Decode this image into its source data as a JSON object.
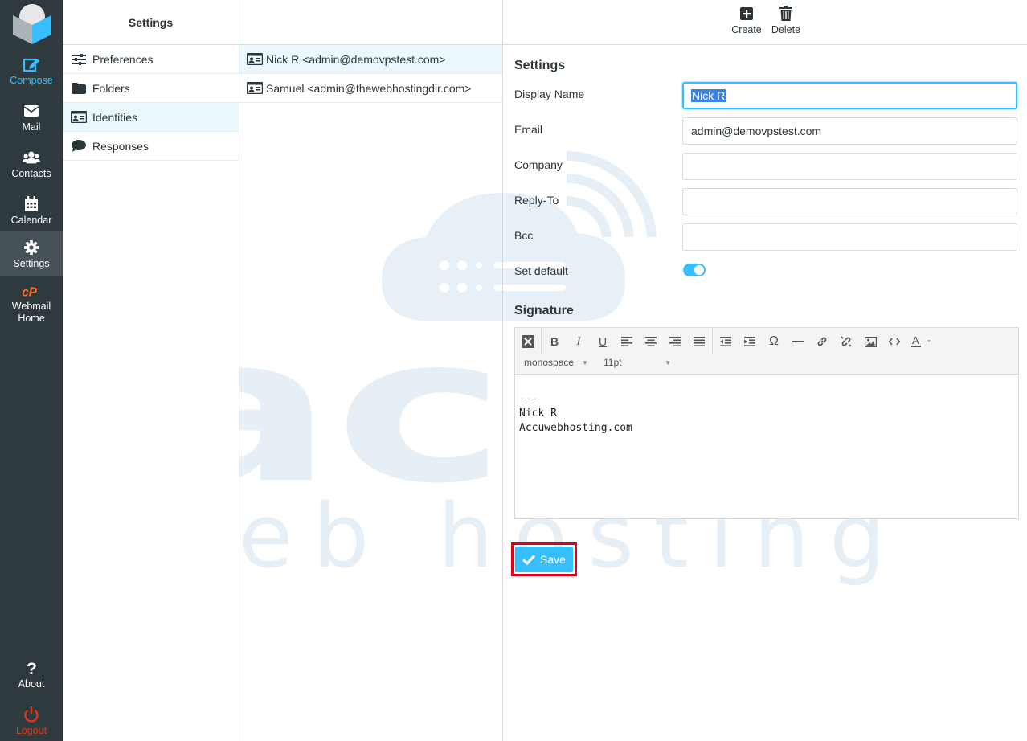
{
  "taskmenu": {
    "items": [
      {
        "label": "Compose"
      },
      {
        "label": "Mail"
      },
      {
        "label": "Contacts"
      },
      {
        "label": "Calendar"
      },
      {
        "label": "Settings"
      },
      {
        "label": "Webmail Home"
      },
      {
        "label": "About"
      },
      {
        "label": "Logout"
      }
    ]
  },
  "settings_panel": {
    "title": "Settings",
    "items": [
      {
        "label": "Preferences",
        "icon": "sliders-icon"
      },
      {
        "label": "Folders",
        "icon": "folder-icon"
      },
      {
        "label": "Identities",
        "icon": "id-card-icon"
      },
      {
        "label": "Responses",
        "icon": "comment-icon"
      }
    ]
  },
  "identities": {
    "items": [
      {
        "label": "Nick R <admin@demovpstest.com>"
      },
      {
        "label": "Samuel <admin@thewebhostingdir.com>"
      }
    ]
  },
  "toolbar": {
    "create_label": "Create",
    "delete_label": "Delete"
  },
  "form": {
    "section_title": "Settings",
    "display_name_label": "Display Name",
    "display_name_value": "Nick R",
    "email_label": "Email",
    "email_value": "admin@demovpstest.com",
    "company_label": "Company",
    "company_value": "",
    "replyto_label": "Reply-To",
    "replyto_value": "",
    "bcc_label": "Bcc",
    "bcc_value": "",
    "set_default_label": "Set default",
    "set_default_value": "on"
  },
  "signature": {
    "section_title": "Signature",
    "font_family": "monospace",
    "font_size": "11pt",
    "text": "---\nNick R\nAccuwebhosting.com"
  },
  "save_label": "Save",
  "watermark": {
    "line1": "accu",
    "line2": "web hosting"
  },
  "colors": {
    "accent": "#37beff",
    "sidebar_bg": "#2f3a3f",
    "highlight_frame": "#e0001a",
    "logout": "#e0361d"
  }
}
